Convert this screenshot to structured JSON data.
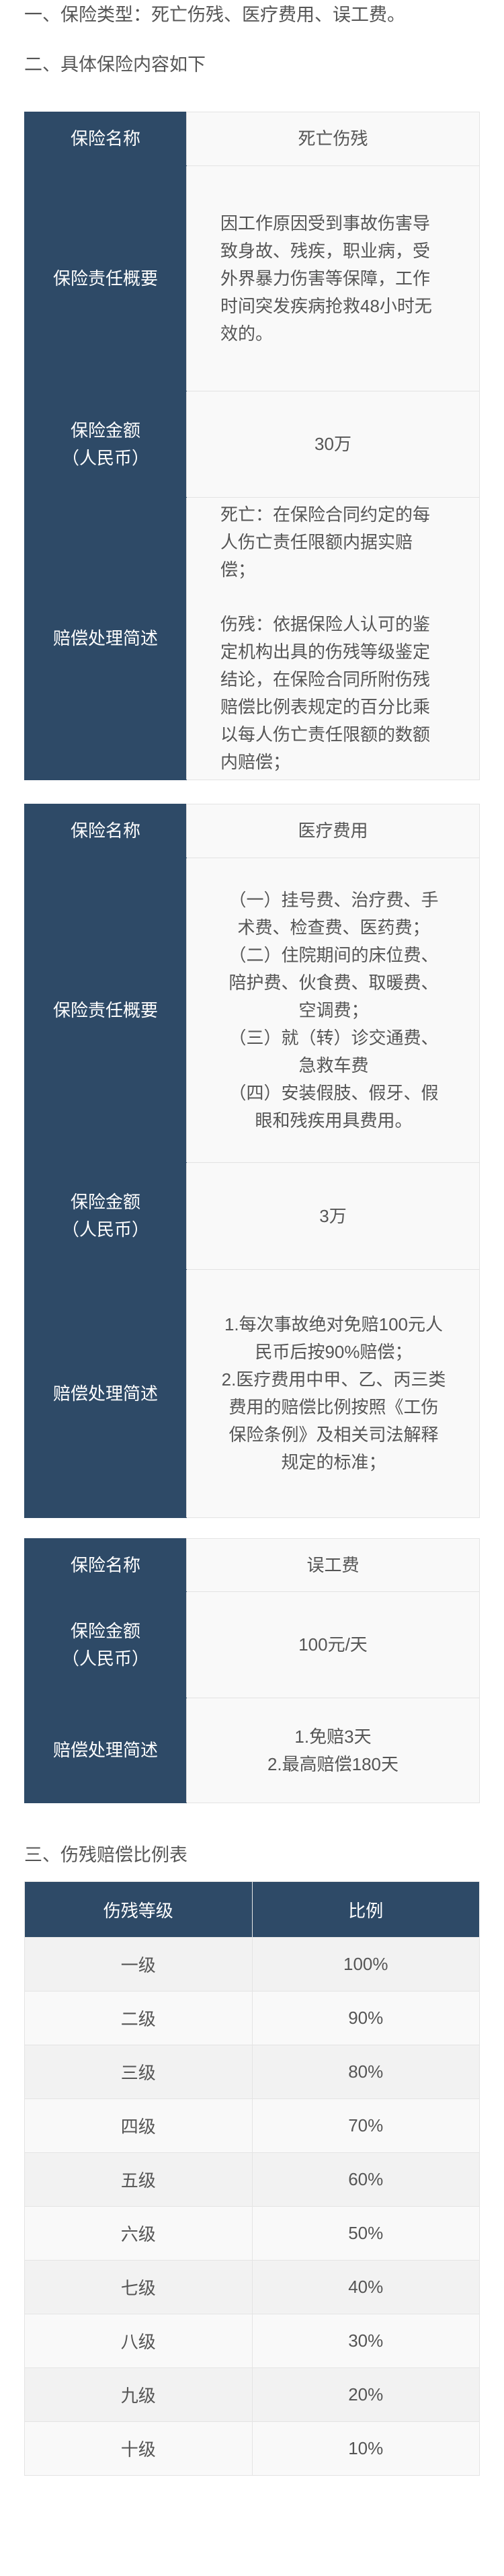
{
  "headings": {
    "h1": "一、保险类型：死亡伤残、医疗费用、误工费。",
    "h2": "二、具体保险内容如下",
    "h3": "三、伤残赔偿比例表"
  },
  "death": {
    "name_label": "保险名称",
    "name_value": "死亡伤残",
    "overview_label": "保险责任概要",
    "overview_text": "因工作原因受到事故伤害导致身故、残疾，职业病，受外界暴力伤害等保障，工作时间突发疾病抢救48小时无效的。",
    "amount_label_1": "保险金额",
    "amount_label_2": "（人民币）",
    "amount_value": "30万",
    "claim_label": "赔偿处理简述",
    "claim_p1": "死亡：在保险合同约定的每人伤亡责任限额内据实赔偿；",
    "claim_p2": "伤残：依据保险人认可的鉴定机构出具的伤残等级鉴定结论，在保险合同所附伤残赔偿比例表规定的百分比乘以每人伤亡责任限额的数额内赔偿；"
  },
  "medical": {
    "name_label": "保险名称",
    "name_value": "医疗费用",
    "overview_label": "保险责任概要",
    "overview_items": [
      "（一）挂号费、治疗费、手术费、检查费、医药费；",
      "（二）住院期间的床位费、陪护费、伙食费、取暖费、空调费；",
      "（三）就（转）诊交通费、急救车费",
      "（四）安装假肢、假牙、假眼和残疾用具费用。"
    ],
    "amount_label_1": "保险金额",
    "amount_label_2": "（人民币）",
    "amount_value": "3万",
    "claim_label": "赔偿处理简述",
    "claim_text": "1.每次事故绝对免赔100元人民币后按90%赔偿；\n2.医疗费用中甲、乙、丙三类费用的赔偿比例按照《工伤保险条例》及相关司法解释规定的标准；"
  },
  "lostwork": {
    "name_label": "保险名称",
    "name_value": "误工费",
    "amount_label_1": "保险金额",
    "amount_label_2": "（人民币）",
    "amount_value": "100元/天",
    "claim_label": "赔偿处理简述",
    "claim_line1": "1.免赔3天",
    "claim_line2": "2.最高赔偿180天"
  },
  "ratio_table": {
    "col_grade": "伤残等级",
    "col_ratio": "比例",
    "rows": [
      {
        "grade": "一级",
        "ratio": "100%"
      },
      {
        "grade": "二级",
        "ratio": "90%"
      },
      {
        "grade": "三级",
        "ratio": "80%"
      },
      {
        "grade": "四级",
        "ratio": "70%"
      },
      {
        "grade": "五级",
        "ratio": "60%"
      },
      {
        "grade": "六级",
        "ratio": "50%"
      },
      {
        "grade": "七级",
        "ratio": "40%"
      },
      {
        "grade": "八级",
        "ratio": "30%"
      },
      {
        "grade": "九级",
        "ratio": "20%"
      },
      {
        "grade": "十级",
        "ratio": "10%"
      }
    ]
  },
  "colors": {
    "header_bg": "#2e4a67",
    "value_bg": "#f9f9f9",
    "row_alt_bg": "#f2f2f2",
    "text": "#555555"
  }
}
